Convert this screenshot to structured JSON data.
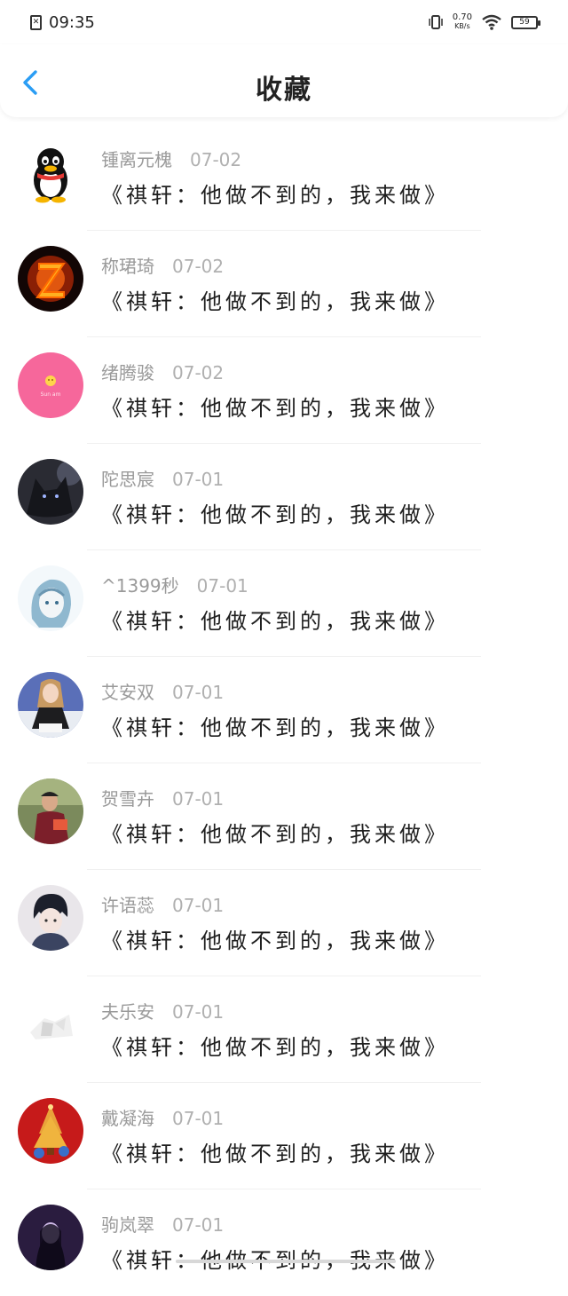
{
  "status": {
    "time": "09:35",
    "speed_value": "0.70",
    "speed_unit": "KB/s",
    "battery": "59"
  },
  "header": {
    "title": "收藏"
  },
  "items": [
    {
      "name": "锺离元槐",
      "date": "07-02",
      "text": "《祺轩：他做不到的，我来做》",
      "avatar": "qq-penguin-avatar"
    },
    {
      "name": "称珺琦",
      "date": "07-02",
      "text": "《祺轩：他做不到的，我来做》",
      "avatar": "fire-z-avatar"
    },
    {
      "name": "绪腾骏",
      "date": "07-02",
      "text": "《祺轩：他做不到的，我来做》",
      "avatar": "pink-sun-avatar",
      "avatar_caption": "Sun am"
    },
    {
      "name": "陀思宸",
      "date": "07-01",
      "text": "《祺轩：他做不到的，我来做》",
      "avatar": "wolf-avatar"
    },
    {
      "name": "^1399秒",
      "date": "07-01",
      "text": "《祺轩：他做不到的，我来做》",
      "avatar": "anime-girl-avatar"
    },
    {
      "name": "艾安双",
      "date": "07-01",
      "text": "《祺轩：他做不到的，我来做》",
      "avatar": "girl-photo-avatar"
    },
    {
      "name": "贺雪卉",
      "date": "07-01",
      "text": "《祺轩：他做不到的，我来做》",
      "avatar": "boy-photo-avatar"
    },
    {
      "name": "许语蕊",
      "date": "07-01",
      "text": "《祺轩：他做不到的，我来做》",
      "avatar": "anime-boy-avatar"
    },
    {
      "name": "夫乐安",
      "date": "07-01",
      "text": "《祺轩：他做不到的，我来做》",
      "avatar": "white-sketch-avatar"
    },
    {
      "name": "戴凝海",
      "date": "07-01",
      "text": "《祺轩：他做不到的，我来做》",
      "avatar": "red-festival-avatar"
    },
    {
      "name": "驹岚翠",
      "date": "07-01",
      "text": "《祺轩：他做不到的，我来做》",
      "avatar": "dark-purple-avatar"
    }
  ],
  "colors": {
    "accent": "#2a9df4",
    "name": "#9a9a9a",
    "date": "#b0b0b0",
    "text": "#1e1e1e"
  }
}
